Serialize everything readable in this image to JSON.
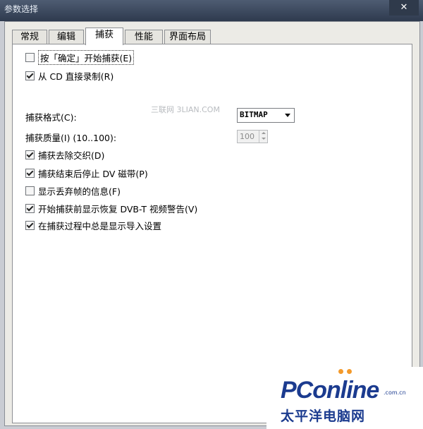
{
  "window": {
    "title": "参数选择",
    "close_glyph": "✕"
  },
  "tabs": [
    {
      "label": "常规",
      "active": false
    },
    {
      "label": "编辑",
      "active": false
    },
    {
      "label": "捕获",
      "active": true
    },
    {
      "label": "性能",
      "active": false
    },
    {
      "label": "界面布局",
      "active": false
    }
  ],
  "capture": {
    "options_top": [
      {
        "label": "按「确定」开始捕获(E)",
        "checked": false,
        "focused": true
      },
      {
        "label": "从 CD 直接录制(R)",
        "checked": true,
        "focused": false
      }
    ],
    "format_label": "捕获格式(C):",
    "format_value": "BITMAP",
    "quality_label": "捕获质量(I) (10..100):",
    "quality_value": "100",
    "options_bottom": [
      {
        "label": "捕获去除交织(D)",
        "checked": true
      },
      {
        "label": "捕获结束后停止 DV 磁带(P)",
        "checked": true
      },
      {
        "label": "显示丢弃帧的信息(F)",
        "checked": false
      },
      {
        "label": "开始捕获前显示恢复 DVB-T 视频警告(V)",
        "checked": true
      },
      {
        "label": "在捕获过程中总是显示导入设置",
        "checked": true
      }
    ]
  },
  "watermarks": {
    "site": "三联网 3LIAN.COM",
    "logo_main": "PConline",
    "logo_domain": ".com.cn",
    "logo_cn": "太平洋电脑网"
  }
}
